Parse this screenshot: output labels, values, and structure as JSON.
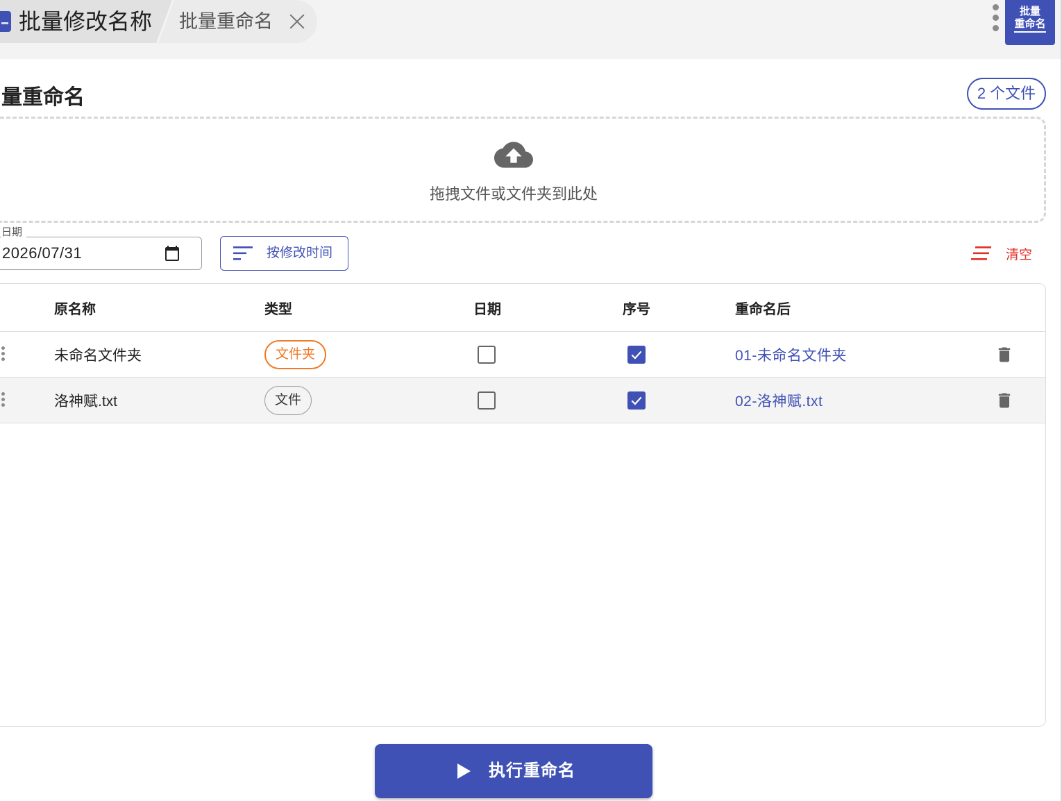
{
  "tabs": [
    {
      "label": "批量修改名称",
      "icon": "app-icon"
    },
    {
      "label": "批量重命名",
      "close_icon": "close-icon"
    }
  ],
  "app_badge": {
    "line1": "批量",
    "line2": "重命名"
  },
  "menu_icon": "more-vert-icon",
  "page": {
    "title": "量重命名",
    "file_count": "2 个文件"
  },
  "dropzone": {
    "icon": "cloud-upload-icon",
    "text": "拖拽文件或文件夹到此处"
  },
  "toolbar": {
    "date_label": "日期",
    "date_value": "2026/07/31",
    "date_icon": "calendar-icon",
    "sort_icon": "sort-icon",
    "sort_label": "按修改时间",
    "clear_icon": "clear-all-icon",
    "clear_label": "清空"
  },
  "table": {
    "columns": [
      "原名称",
      "类型",
      "日期",
      "序号",
      "重命名后"
    ],
    "rows": [
      {
        "name": "未命名文件夹",
        "type": "文件夹",
        "date_checked": false,
        "seq_checked": true,
        "renamed": "01-未命名文件夹"
      },
      {
        "name": "洛神赋.txt",
        "type": "文件",
        "date_checked": false,
        "seq_checked": true,
        "renamed": "02-洛神赋.txt"
      }
    ],
    "row_icons": {
      "drag": "drag-handle-icon",
      "delete": "trash-icon"
    }
  },
  "actions": {
    "run_icon": "play-icon",
    "run_label": "执行重命名"
  },
  "colors": {
    "primary": "#3f51b5",
    "danger": "#e0302a",
    "folder_chip": "#f07a26"
  }
}
